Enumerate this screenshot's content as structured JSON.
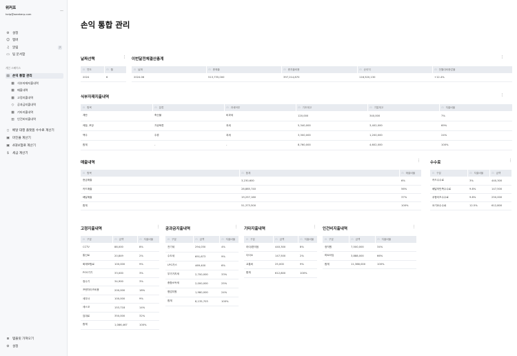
{
  "sidebar": {
    "user_name": "위커프",
    "user_email": "help@weekerp.com",
    "collapse_icon": "minus-icon",
    "top_items": [
      {
        "label": "설정",
        "icon": "gear-icon"
      },
      {
        "label": "멤버",
        "icon": "member-icon"
      },
      {
        "label": "알림",
        "icon": "bell-icon",
        "badge": "7"
      },
      {
        "label": "팀 문서함",
        "icon": "folder-icon"
      }
    ],
    "section_label": "개인 스페이스",
    "menu_items": [
      {
        "label": "손익 통합 관리",
        "icon": "document-icon",
        "active": true,
        "sub": false
      },
      {
        "label": "식부자재지출내역",
        "icon": "table-icon",
        "sub": true
      },
      {
        "label": "매출내역",
        "icon": "table-icon",
        "sub": true
      },
      {
        "label": "고정지출내역",
        "icon": "table-icon",
        "sub": true
      },
      {
        "label": "공과금지출내역",
        "icon": "diamond-icon",
        "sub": true
      },
      {
        "label": "기타지출내역",
        "icon": "table-icon",
        "sub": true
      },
      {
        "label": "인건비지출내역",
        "icon": "bar-chart-icon",
        "sub": true
      },
      {
        "label": "배달 대행 플랫폼 수수료 계산기",
        "icon": "phone-icon",
        "sub": false
      },
      {
        "label": "마진율 계산기",
        "icon": "calculator-icon",
        "sub": false
      },
      {
        "label": "4대보험료 계산기",
        "icon": "calculator-icon",
        "sub": false
      },
      {
        "label": "세금 계산기",
        "icon": "dollar-icon",
        "sub": false
      }
    ],
    "bottom_items": [
      {
        "label": "템플릿 가져오기",
        "icon": "template-icon"
      },
      {
        "label": "설정",
        "icon": "gear-icon"
      }
    ]
  },
  "page": {
    "title": "손익 통합 관리"
  },
  "date_card": {
    "title": "날짜선택",
    "headers": [
      "연도",
      "월"
    ],
    "rows": [
      [
        "2024",
        "6"
      ]
    ]
  },
  "summary_card": {
    "title": "이번달전체결산총계",
    "headers": [
      "날짜",
      "총매출",
      "총지출비용",
      "순이익",
      "전월대비증감율"
    ],
    "rows": [
      [
        "2024.06",
        "513,735,000",
        "397,214,870",
        "116,520,130",
        "+12.4%"
      ]
    ]
  },
  "ingredient_card": {
    "title": "식부자재지출내역",
    "headers": [
      "항목",
      "분류",
      "과세여부",
      "기초재고",
      "기말재고",
      "지출비율"
    ],
    "rows": [
      [
        "계란",
        "축산물",
        "비과세",
        "120,000",
        "340,000",
        "7%"
      ],
      [
        "케찹, 포장",
        "가공육류",
        "과세",
        "5,340,000",
        "3,402,000",
        "69%"
      ],
      [
        "맥주",
        "주류",
        "과세",
        "3,300,000",
        "1,200,000",
        "24%"
      ],
      [
        "합계",
        "-",
        "-",
        "8,760,000",
        "4,602,000",
        "100%"
      ]
    ]
  },
  "sales_card": {
    "title": "매출내역",
    "headers": [
      "항목",
      "합계",
      "매출비율"
    ],
    "rows": [
      [
        "현금매출",
        "3,230,600",
        "6%"
      ],
      [
        "카드매출",
        "28,885,740",
        "56%"
      ],
      [
        "배달매출",
        "19,257,160",
        "37%"
      ],
      [
        "합계",
        "51,373,500",
        "100%"
      ]
    ]
  },
  "fee_card": {
    "title": "수수료",
    "headers": [
      "구분",
      "지출비율",
      "금액"
    ],
    "rows": [
      [
        "카드수수료",
        "3%",
        "440,300"
      ],
      [
        "배달의민족수수료",
        "9.8%",
        "147,500"
      ],
      [
        "쿠팡이츠수수료",
        "9.8%",
        "250,000"
      ],
      [
        "요기요수수료",
        "12.5%",
        "612,800"
      ]
    ]
  },
  "fixed_card": {
    "title": "고정지출내역",
    "headers": [
      "구분",
      "금액",
      "지출비율"
    ],
    "rows": [
      [
        "CCTV",
        "88,000",
        "8%"
      ],
      [
        "통신료",
        "20,849",
        "2%"
      ],
      [
        "화재보험료",
        "100,000",
        "9%"
      ],
      [
        "POS기기",
        "33,000",
        "3%"
      ],
      [
        "정수기",
        "34,900",
        "3%"
      ],
      [
        "프랜차이즈비용",
        "200,000",
        "18%"
      ],
      [
        "세무사",
        "100,000",
        "9%"
      ],
      [
        "세스코",
        "153,718",
        "14%"
      ],
      [
        "임대료",
        "350,000",
        "32%"
      ],
      [
        "합계",
        "1,086,467",
        "100%"
      ]
    ]
  },
  "utility_card": {
    "title": "공과금지출내역",
    "headers": [
      "구분",
      "금액",
      "지출비율"
    ],
    "rows": [
      [
        "전기세",
        "294,030",
        "4%"
      ],
      [
        "수도세",
        "691,673",
        "9%"
      ],
      [
        "LPG가스",
        "469,400",
        "6%"
      ],
      [
        "부가가치세",
        "2,700,000",
        "33%"
      ],
      [
        "종합소득세",
        "2,000,000",
        "25%"
      ],
      [
        "협업지원",
        "1,980,000",
        "24%"
      ],
      [
        "합계",
        "8,135,703",
        "100%"
      ]
    ]
  },
  "other_card": {
    "title": "기타지출내역",
    "headers": [
      "구분",
      "금액",
      "지출비율"
    ],
    "rows": [
      [
        "라이/편의점",
        "440,300",
        "8%"
      ],
      [
        "다이소",
        "147,500",
        "2%"
      ],
      [
        "교통비",
        "25,000",
        "9%"
      ],
      [
        "합계",
        "612,800",
        "100%"
      ]
    ]
  },
  "labor_card": {
    "title": "인건비지출내역",
    "headers": [
      "구분",
      "금액",
      "지출비율"
    ],
    "rows": [
      [
        "정직원",
        "7,500,000",
        "34%"
      ],
      [
        "파트타임",
        "3,888,000",
        "66%"
      ],
      [
        "합계",
        "11,388,000",
        "100%"
      ]
    ]
  }
}
